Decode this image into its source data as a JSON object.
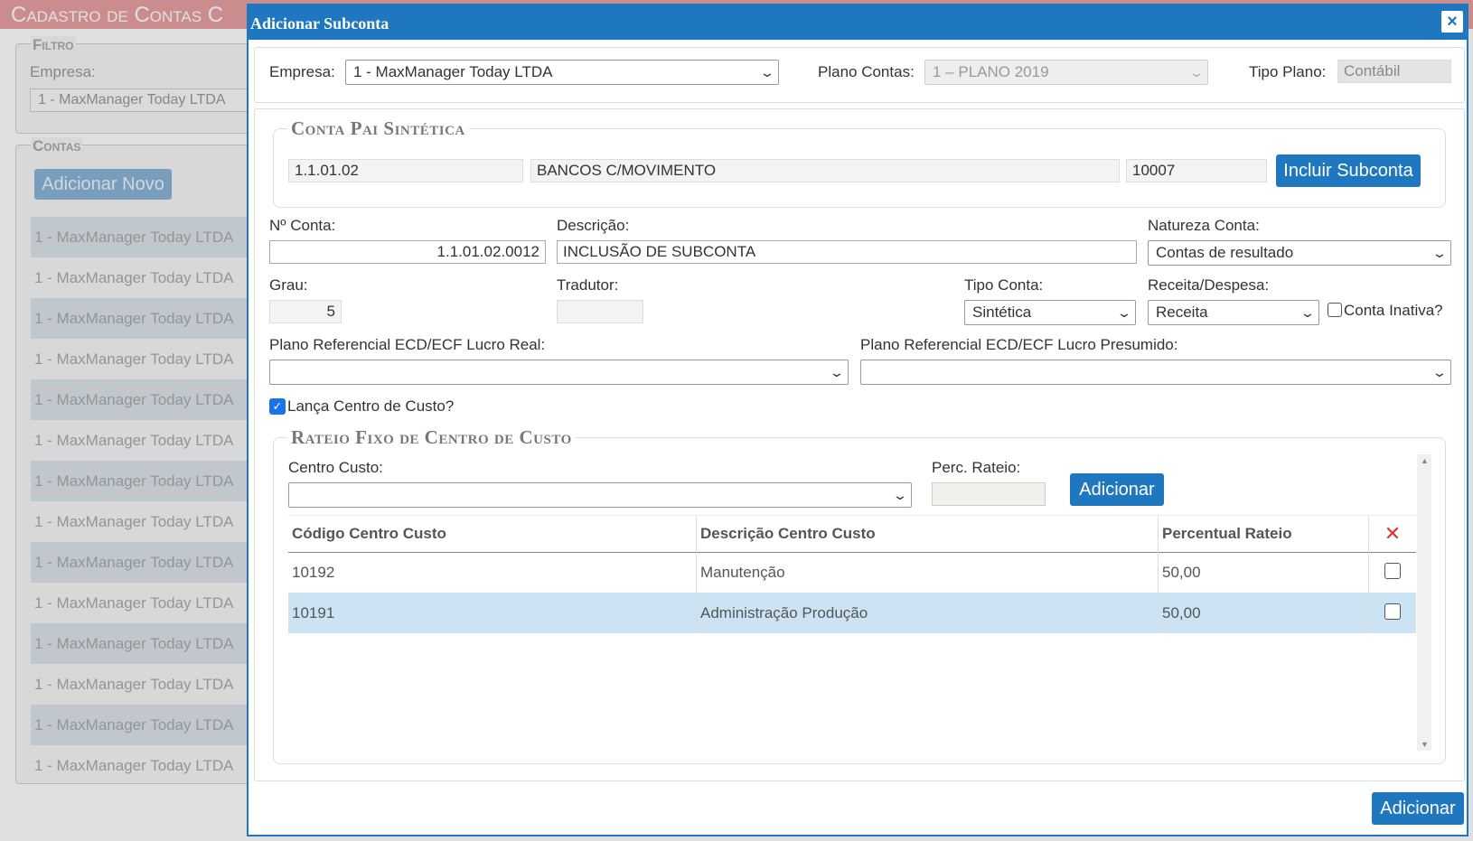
{
  "background": {
    "title": "Cadastro de Contas C",
    "filter_legend": "Filtro",
    "empresa_label": "Empresa:",
    "empresa_value": "1 - MaxManager Today LTDA",
    "contas_legend": "Contas",
    "add_new_label": "Adicionar Novo",
    "rows": [
      "1 - MaxManager Today LTDA",
      "1 - MaxManager Today LTDA",
      "1 - MaxManager Today LTDA",
      "1 - MaxManager Today LTDA",
      "1 - MaxManager Today LTDA",
      "1 - MaxManager Today LTDA",
      "1 - MaxManager Today LTDA",
      "1 - MaxManager Today LTDA",
      "1 - MaxManager Today LTDA",
      "1 - MaxManager Today LTDA",
      "1 - MaxManager Today LTDA",
      "1 - MaxManager Today LTDA",
      "1 - MaxManager Today LTDA",
      "1 - MaxManager Today LTDA"
    ]
  },
  "modal": {
    "title": "Adicionar Subconta",
    "close_glyph": "×",
    "top": {
      "empresa_label": "Empresa:",
      "empresa_value": "1 - MaxManager Today LTDA",
      "plano_label": "Plano Contas:",
      "plano_value": "1 – PLANO 2019",
      "tipo_label": "Tipo Plano:",
      "tipo_value": "Contábil"
    },
    "parent": {
      "legend": "Conta Pai Sintética",
      "code": "1.1.01.02",
      "description": "BANCOS C/MOVIMENTO",
      "id": "10007",
      "include_button": "Incluir Subconta"
    },
    "form": {
      "numero_label": "Nº Conta:",
      "numero_value": "1.1.01.02.0012",
      "descricao_label": "Descrição:",
      "descricao_value": "INCLUSÃO DE SUBCONTA",
      "natureza_label": "Natureza Conta:",
      "natureza_value": "Contas de resultado",
      "grau_label": "Grau:",
      "grau_value": "5",
      "tradutor_label": "Tradutor:",
      "tradutor_value": "",
      "tipo_conta_label": "Tipo Conta:",
      "tipo_conta_value": "Sintética",
      "receita_label": "Receita/Despesa:",
      "receita_value": "Receita",
      "inativa_label": "Conta Inativa?",
      "inativa_checked": false,
      "ref_real_label": "Plano Referencial ECD/ECF Lucro Real:",
      "ref_real_value": "",
      "ref_presumido_label": "Plano Referencial ECD/ECF Lucro Presumido:",
      "ref_presumido_value": "",
      "centro_custo_label": "Lança Centro de Custo?",
      "centro_custo_checked": true
    },
    "rateio": {
      "legend": "Rateio Fixo de Centro de Custo",
      "centro_label": "Centro Custo:",
      "centro_value": "",
      "perc_label": "Perc. Rateio:",
      "perc_value": "",
      "add_button": "Adicionar",
      "columns": [
        "Código Centro Custo",
        "Descrição Centro Custo",
        "Percentual Rateio"
      ],
      "delete_icon_glyph": "✕",
      "rows": [
        {
          "codigo": "10192",
          "descricao": "Manutenção",
          "percentual": "50,00",
          "selected": false
        },
        {
          "codigo": "10191",
          "descricao": "Administração Produção",
          "percentual": "50,00",
          "selected": true
        }
      ]
    },
    "footer_button": "Adicionar"
  }
}
